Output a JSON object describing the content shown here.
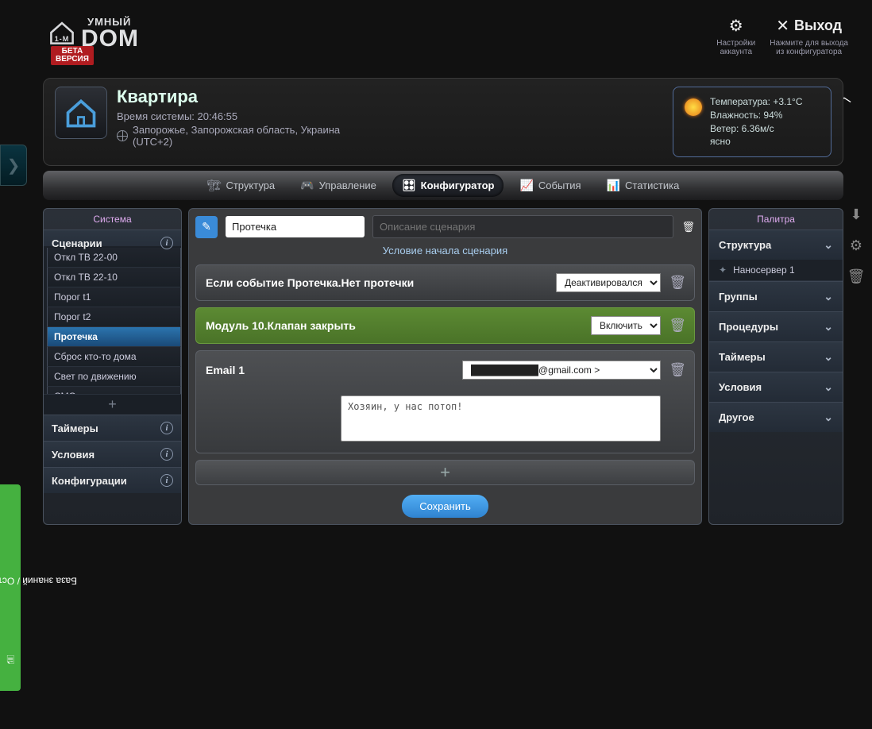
{
  "logo": {
    "top": "УМНЫЙ",
    "main": "DОМ",
    "beta": "БЕТА\nВЕРСИЯ"
  },
  "top_actions": {
    "settings": {
      "sub": "Настройки\nаккаунта"
    },
    "exit": {
      "label": "Выход",
      "sub": "Нажмите для выхода\nиз конфигуратора"
    }
  },
  "header": {
    "title": "Квартира",
    "time": "Время системы: 20:46:55",
    "location": "Запорожье, Запорожская область, Украина (UTC+2)"
  },
  "weather": {
    "temp": "Температура: +3.1°C",
    "hum": "Влажность: 94%",
    "wind": "Ветер: 6.36м/с",
    "cond": "ясно"
  },
  "tabs": {
    "structure": "Структура",
    "control": "Управление",
    "config": "Конфигуратор",
    "events": "События",
    "stats": "Статистика"
  },
  "system": {
    "title": "Система",
    "cats": {
      "scenarios": "Сценарии",
      "timers": "Таймеры",
      "conditions": "Условия",
      "configs": "Конфигурации"
    },
    "scenario_items": [
      "Откл ТВ 22-00",
      "Откл ТВ 22-10",
      "Порог t1",
      "Порог t2",
      "Протечка",
      "Сброс кто-то дома",
      "Свет по движению",
      "СМС по кнопке"
    ],
    "selected_index": 4
  },
  "editor": {
    "name_value": "Протечка",
    "desc_placeholder": "Описание сценария",
    "cond_title": "Условие начала сценария",
    "cond_label": "Если событие Протечка.Нет протечки",
    "cond_select": "Деактивировался",
    "action_label": "Модуль 10.Клапан закрыть",
    "action_select": "Включить",
    "email_label": "Email 1",
    "email_select": "██████████@gmail.com >",
    "email_body": "Хозяин, у нас потоп!",
    "save": "Сохранить"
  },
  "palette": {
    "title": "Палитра",
    "cats": {
      "structure": "Структура",
      "structure_item": "Наносервер 1",
      "groups": "Группы",
      "procedures": "Процедуры",
      "timers": "Таймеры",
      "conditions": "Условия",
      "other": "Другое"
    }
  },
  "feedback": "База знаний / Оставить отзыв"
}
